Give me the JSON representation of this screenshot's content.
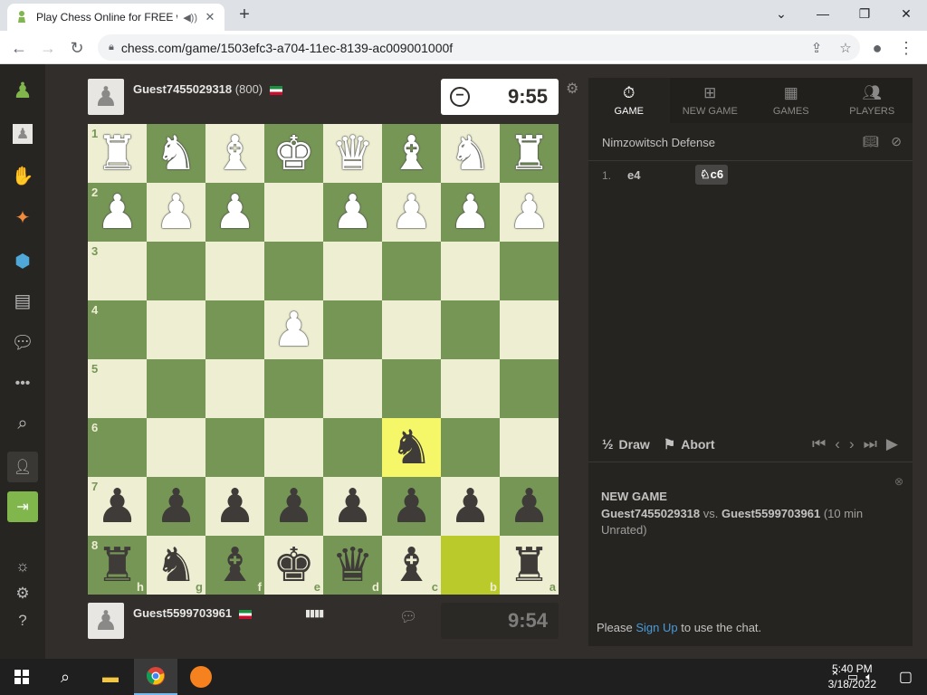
{
  "browser": {
    "tab_title": "Play Chess Online for FREE w",
    "url": "chess.com/game/1503efc3-a704-11ec-8139-ac009001000f"
  },
  "top_player": {
    "name": "Guest7455029318",
    "rating": "(800)",
    "clock": "9:55"
  },
  "bottom_player": {
    "name": "Guest5599703961",
    "clock": "9:54"
  },
  "board": {
    "ranks": [
      "1",
      "2",
      "3",
      "4",
      "5",
      "6",
      "7",
      "8"
    ],
    "files": [
      "h",
      "g",
      "f",
      "e",
      "d",
      "c",
      "b",
      "a"
    ],
    "rows": [
      [
        "wR",
        "wN",
        "wB",
        "wK",
        "wQ",
        "wB",
        "wN",
        "wR"
      ],
      [
        "wP",
        "wP",
        "wP",
        "",
        "wP",
        "wP",
        "wP",
        "wP"
      ],
      [
        "",
        "",
        "",
        "",
        "",
        "",
        "",
        ""
      ],
      [
        "",
        "",
        "",
        "wP",
        "",
        "",
        "",
        ""
      ],
      [
        "",
        "",
        "",
        "",
        "",
        "",
        "",
        ""
      ],
      [
        "",
        "",
        "",
        "",
        "",
        "bN",
        "",
        ""
      ],
      [
        "bP",
        "bP",
        "bP",
        "bP",
        "bP",
        "bP",
        "bP",
        "bP"
      ],
      [
        "bR",
        "bN",
        "bB",
        "bK",
        "bQ",
        "bB",
        "",
        "bR"
      ]
    ],
    "highlights": [
      [
        5,
        5
      ],
      [
        7,
        6
      ]
    ]
  },
  "panel": {
    "tabs": [
      {
        "label": "GAME",
        "icon": "stopwatch-icon"
      },
      {
        "label": "NEW GAME",
        "icon": "plus-icon"
      },
      {
        "label": "GAMES",
        "icon": "board-icon"
      },
      {
        "label": "PLAYERS",
        "icon": "people-icon"
      }
    ],
    "opening": "Nimzowitsch Defense",
    "moves": {
      "num": "1.",
      "white": "e4",
      "black": "c6"
    },
    "draw_label": "Draw",
    "draw_symbol": "½",
    "abort_label": "Abort",
    "log_title": "NEW GAME",
    "log_white": "Guest7455029318",
    "log_vs": "vs.",
    "log_black": "Guest5599703961",
    "log_details": "(10 min Unrated)",
    "chat_prefix": "Please",
    "chat_link": "Sign Up",
    "chat_suffix": "to use the chat."
  },
  "taskbar": {
    "time": "5:40 PM",
    "date": "3/18/2022"
  },
  "colors": {
    "light_square": "#eeeed2",
    "dark_square": "#769656",
    "highlight": "#f6f669"
  }
}
